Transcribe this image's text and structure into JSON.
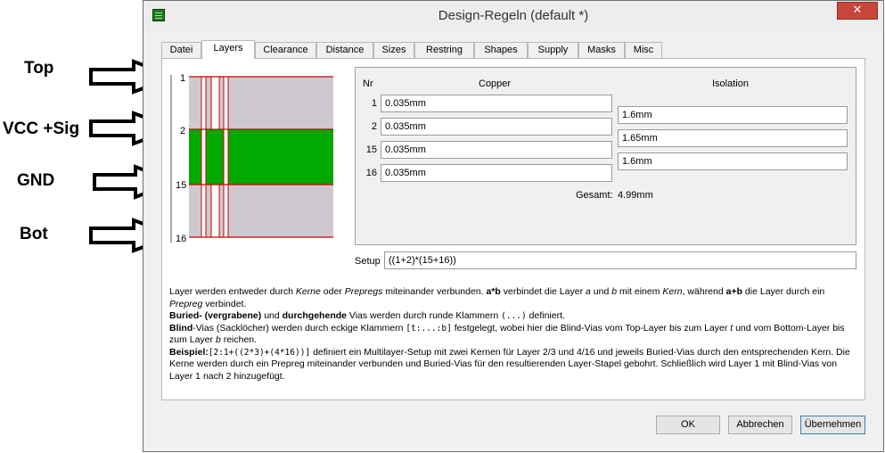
{
  "annotations": {
    "top": "Top",
    "vcc": "VCC +Sig",
    "gnd": "GND",
    "bot": "Bot"
  },
  "window": {
    "title": "Design-Regeln (default *)",
    "close": "✕"
  },
  "tabs": [
    "Datei",
    "Layers",
    "Clearance",
    "Distance",
    "Sizes",
    "Restring",
    "Shapes",
    "Supply",
    "Masks",
    "Misc"
  ],
  "active_tab": "Layers",
  "diagram": {
    "layers": [
      "1",
      "2",
      "15",
      "16"
    ]
  },
  "grid": {
    "col_nr": "Nr",
    "col_copper": "Copper",
    "col_isolation": "Isolation",
    "rows": [
      {
        "nr": "1",
        "copper": "0.035mm"
      },
      {
        "nr": "2",
        "copper": "0.035mm"
      },
      {
        "nr": "15",
        "copper": "0.035mm"
      },
      {
        "nr": "16",
        "copper": "0.035mm"
      }
    ],
    "isolation": [
      "1.6mm",
      "1.65mm",
      "1.6mm"
    ],
    "total_label": "Gesamt:",
    "total_value": "4.99mm"
  },
  "setup": {
    "label": "Setup",
    "value": "((1+2)*(15+16))"
  },
  "help": {
    "l1a": "Layer werden entweder durch ",
    "l1b": "Kerne",
    "l1c": " oder ",
    "l1d": "Prepregs",
    "l1e": " miteinander verbunden. ",
    "l1f": "a*b",
    "l1g": " verbindet die Layer ",
    "l1h": "a",
    "l1i": " und ",
    "l1j": "b",
    "l1k": " mit einem ",
    "l1l": "Kern",
    "l1m": ", während ",
    "l1n": "a+b",
    "l1o": " die Layer durch ein ",
    "l1p": "Prepreg",
    "l1q": " verbindet.",
    "l2a": "Buried- (vergrabene)",
    "l2b": " und ",
    "l2c": "durchgehende",
    "l2d": " Vias werden durch runde Klammern ",
    "l2e": "(...)",
    "l2f": " definiert.",
    "l3a": "Blind",
    "l3b": "-Vias (Sacklöcher) werden durch eckige Klammern ",
    "l3c": "[t:...:b]",
    "l3d": " festgelegt, wobei hier die Blind-Vias vom Top-Layer bis zum Layer ",
    "l3e": "t",
    "l3f": " und vom Bottom-Layer bis zum Layer ",
    "l3g": "b",
    "l3h": " reichen.",
    "l4a": "Beispiel:",
    "l4b": "[2:1+((2*3)+(4*16))]",
    "l4c": " definiert ein Multilayer-Setup mit zwei Kernen für Layer 2/3 und 4/16 und jeweils Buried-Vias durch den entsprechenden Kern. Die Kerne werden durch ein Prepreg miteinander verbunden und Buried-Vias für den resultierenden Layer-Stapel gebohrt. Schließlich wird Layer 1 mit Blind-Vias von Layer 1 nach 2 hinzugefügt."
  },
  "buttons": {
    "ok": "OK",
    "cancel": "Abbrechen",
    "apply": "Übernehmen"
  },
  "colors": {
    "core": "#00aa00",
    "prepreg": "#d0c8d0",
    "via_border": "#cc0000"
  }
}
